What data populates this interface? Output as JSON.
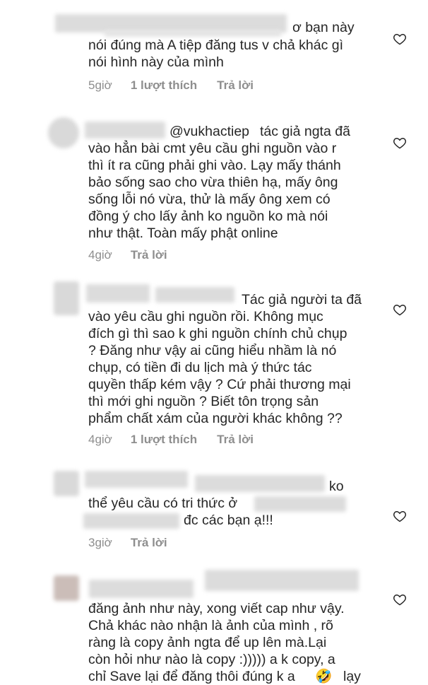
{
  "comments": [
    {
      "lines": [
        "ơ bạn này",
        "nói đúng mà A tiệp đăng tus v chả khác gì",
        "nói hình này của mình"
      ],
      "time": "5giờ",
      "likes": "1 lượt thích",
      "reply": "Trả lời"
    },
    {
      "mention": "@vukhactiep",
      "lines": [
        "tác giả ngta đã",
        "vào hẳn bài cmt yêu cầu ghi nguồn vào r",
        "thì ít ra cũng phải ghi vào. Lạy mấy thánh",
        "bảo sống sao cho vừa thiên hạ, mấy ông",
        "sống lỗi nó vừa, thử là mấy ông xem có",
        "đồng ý cho lấy ảnh ko nguồn ko mà nói",
        "như thật. Toàn mấy phật online"
      ],
      "time": "4giờ",
      "reply": "Trả lời"
    },
    {
      "lines": [
        "Tác giả người ta đã",
        "vào yêu cầu ghi nguồn rồi. Không mục",
        "đích gì thì sao k ghi nguồn chính chủ chụp",
        "? Đăng như vậy ai cũng hiểu nhầm là nó",
        "chụp, có tiền đi du lịch mà ý thức tác",
        "quyền thấp kém vậy ? Cứ phải thương mại",
        "thì mới ghi nguồn ? Biết tôn trọng sản",
        "phẩm chất xám của người khác không ??"
      ],
      "time": "4giờ",
      "likes": "1 lượt thích",
      "reply": "Trả lời"
    },
    {
      "lines": [
        "ko",
        "thể yêu cầu có tri thức ở",
        "đc các bạn ạ!!!"
      ],
      "time": "3giờ",
      "reply": "Trả lời"
    },
    {
      "lines": [
        "đăng ảnh như này, xong viết cap như vậy.",
        "Chả khác nào nhận là ảnh của mình , rõ",
        "ràng là copy ảnh ngta để up lên mà.Lại",
        "còn hỏi như nào là copy :))))) a k copy, a",
        "chỉ Save lại để đăng thôi đúng k a",
        "lạy"
      ],
      "emoji": "🤣"
    }
  ],
  "icons": {
    "like": "heart-outline-icon"
  }
}
